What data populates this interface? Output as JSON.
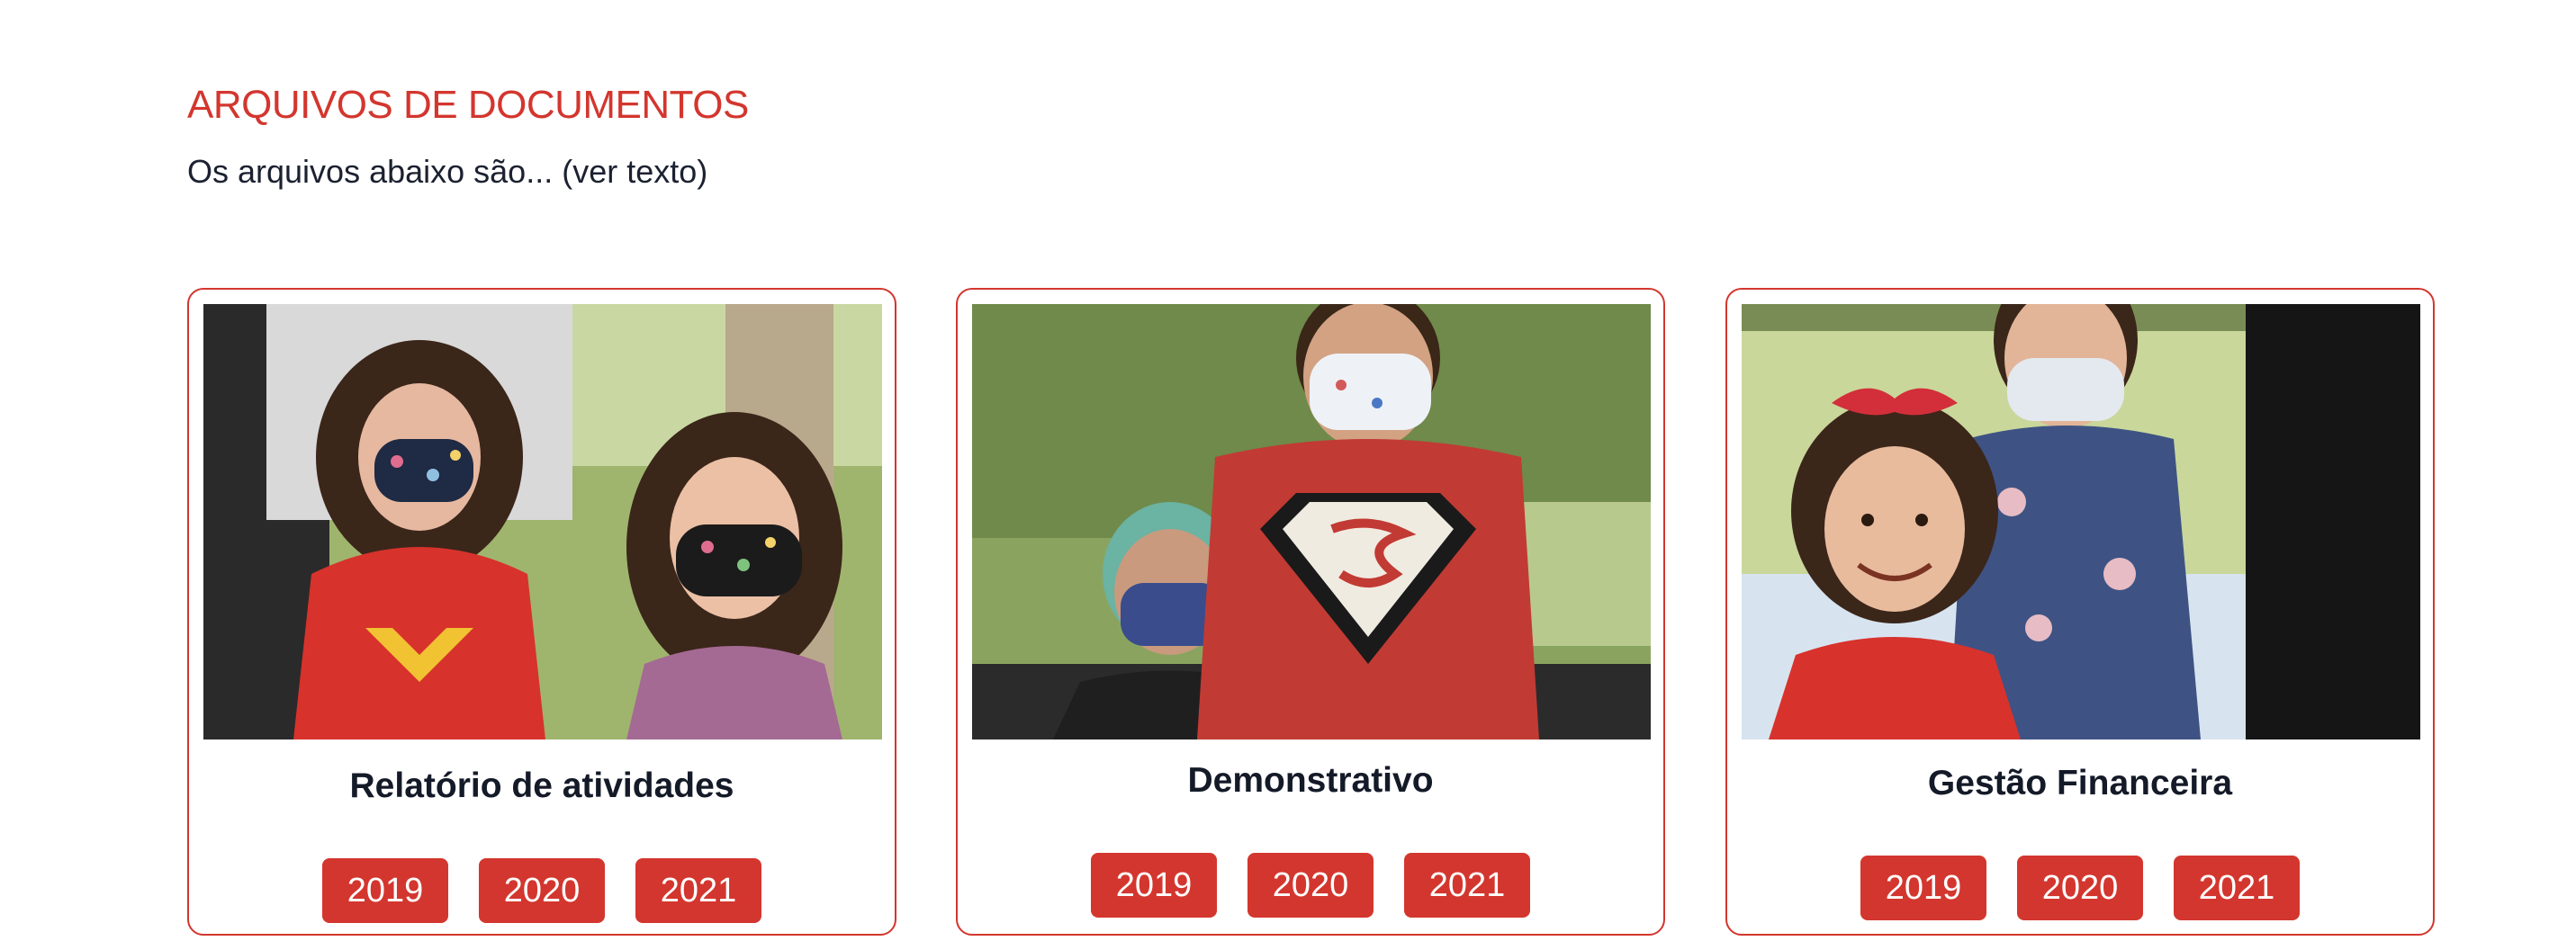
{
  "section": {
    "title": "ARQUIVOS DE DOCUMENTOS",
    "subtitle": "Os arquivos abaixo são... (ver texto)"
  },
  "cards": [
    {
      "title": "Relatório de atividades",
      "years": [
        "2019",
        "2020",
        "2021"
      ],
      "photo_alt": "Duas meninas de máscara sentadas ao ar livre"
    },
    {
      "title": "Demonstrativo",
      "years": [
        "2019",
        "2020",
        "2021"
      ],
      "photo_alt": "Dois meninos de máscara, um com camiseta do Super-Homem"
    },
    {
      "title": "Gestão Financeira",
      "years": [
        "2019",
        "2020",
        "2021"
      ],
      "photo_alt": "Menina sorrindo com laço vermelho ao lado de outra criança de máscara"
    }
  ],
  "colors": {
    "accent": "#d3362e",
    "text_dark": "#141a28",
    "background": "#ffffff"
  }
}
